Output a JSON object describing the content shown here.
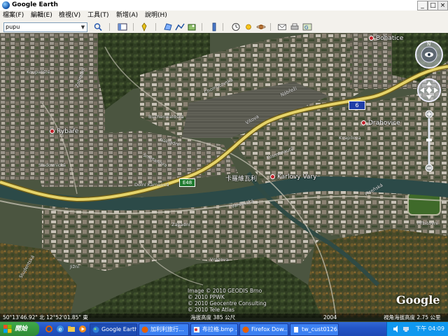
{
  "window": {
    "title": "Google Earth",
    "controls": {
      "minimize": "_",
      "maximize": "□",
      "close": "×"
    }
  },
  "menu": [
    "檔案(F)",
    "編輯(E)",
    "檢視(V)",
    "工具(T)",
    "新增(A)",
    "說明(H)"
  ],
  "toolbar": {
    "search_value": "pupu",
    "buttons": [
      "search-icon",
      "sidebar-icon",
      "placemark-icon",
      "polygon-icon",
      "path-icon",
      "overlay-icon",
      "tour-icon",
      "history-icon",
      "sun-icon",
      "planet-icon",
      "email-icon",
      "print-icon",
      "maps-icon"
    ]
  },
  "map": {
    "places": {
      "rybare": "Rybaře",
      "bohatice": "Bohatice",
      "drahovice": "Drahovice",
      "karlovy_vary_cn": "卡羅維瓦利",
      "karlovy_vary": "Karlovy Vary"
    },
    "streets": {
      "koupaliste": "Koupaliště",
      "zahradni": "Zahradní",
      "buchenwaldska": "Buchenwaldská",
      "chomutovska": "Chomutovská",
      "nakladni": "Nákladní",
      "smetanova": "Smetanova",
      "sladovnicka": "Sladovnická",
      "dolni_kamenne": "Dolní Kamenná",
      "vitova": "Vítova",
      "kvapilova": "Kvapilova",
      "nabrezi": "Nábřeží",
      "varsavska": "Varšavská",
      "zapadni": "Západní",
      "vrazova": "Vrázova",
      "hrbitovni": "Hřbitovní",
      "jizni": "Jižní",
      "kosmonautu": "Kosmonautů",
      "plzenska": "Plzeňská",
      "studentska": "Studentská"
    },
    "road_shields": {
      "route_6": "6",
      "e48": "E48"
    },
    "credits": [
      "Image © 2010 GEODIS Brno",
      "© 2010 PPWK",
      "© 2010 Geocentre Consulting",
      "© 2010 Tele Atlas"
    ],
    "logo": "Google",
    "colors": {
      "highway": "#e6d46a",
      "river": "#2c4a48",
      "forest": "#2e3d22"
    }
  },
  "status": {
    "coords": "50°13'46.92\" 北   12°52'01.85\" 東",
    "elevation": "海拔高度 385 公尺",
    "year": "2004",
    "eye_alt": "視角海拔高度 2.75 公里"
  },
  "taskbar": {
    "start": "開始",
    "tasks": [
      "Google Earth",
      "加利利旅行...",
      "布拉格.bmp ...",
      "Firefox Dow...",
      "tw_cust0126..."
    ],
    "clock": "下午 04:09"
  }
}
